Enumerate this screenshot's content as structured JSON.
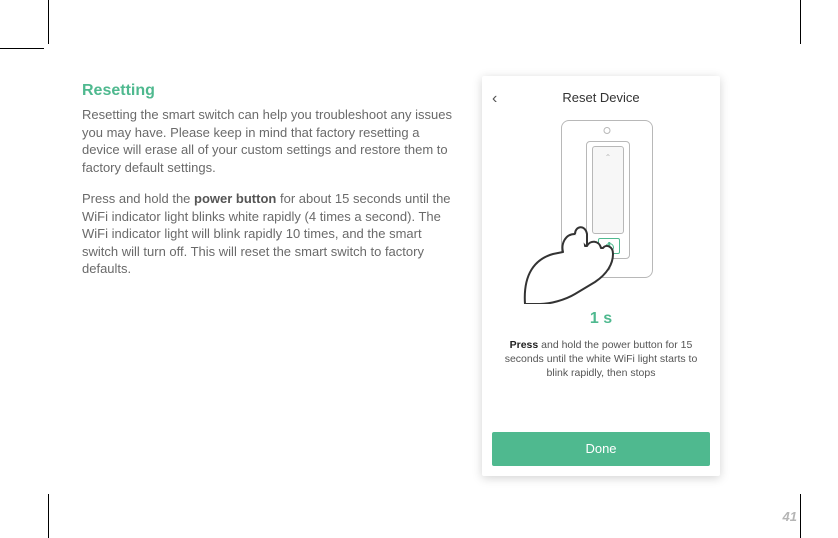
{
  "section": {
    "title": "Resetting",
    "para1": "Resetting the smart switch can help you troubleshoot any issues you may have. Please keep in mind that factory resetting a device will erase all of your custom settings and restore them to factory default settings.",
    "para2_pre": "Press and hold the ",
    "para2_bold": "power button",
    "para2_post": " for about 15 seconds until the WiFi indicator light blinks white rapidly (4 times a second). The WiFi indicator light will blink rapidly 10 times, and the smart switch will turn off. This will reset the smart switch to factory defaults."
  },
  "phone": {
    "back_glyph": "‹",
    "screen_title": "Reset Device",
    "timer": "1 s",
    "instruction_lead": "Press",
    "instruction_rest": " and hold the power button for 15 seconds until the white WiFi light starts to blink rapidly, then stops",
    "done_label": "Done"
  },
  "page_number": "41",
  "colors": {
    "accent": "#4fb98f",
    "body": "#6a6a6a"
  }
}
